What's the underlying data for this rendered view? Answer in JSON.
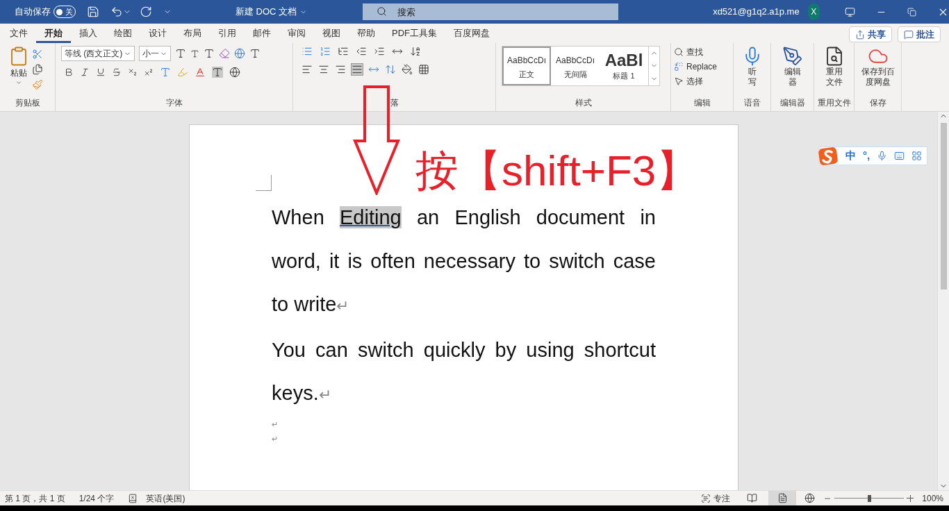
{
  "title_bar": {
    "autosave_label": "自动保存",
    "autosave": {
      "on": false,
      "label": "关"
    },
    "title": "新建 DOC 文档",
    "search": {
      "placeholder": "搜索"
    },
    "user": "xd521@g1q2.a1p.me",
    "avatar": "X"
  },
  "tabs": [
    {
      "label": "文件",
      "selected": false
    },
    {
      "label": "开始",
      "selected": true
    },
    {
      "label": "插入",
      "selected": false
    },
    {
      "label": "绘图",
      "selected": false
    },
    {
      "label": "设计",
      "selected": false
    },
    {
      "label": "布局",
      "selected": false
    },
    {
      "label": "引用",
      "selected": false
    },
    {
      "label": "邮件",
      "selected": false
    },
    {
      "label": "审阅",
      "selected": false
    },
    {
      "label": "视图",
      "selected": false
    },
    {
      "label": "帮助",
      "selected": false
    },
    {
      "label": "PDF工具集",
      "selected": false
    },
    {
      "label": "百度网盘",
      "selected": false
    }
  ],
  "share_buttons": [
    "共享",
    "批注"
  ],
  "ribbon": {
    "clipboard": {
      "paste": "粘贴",
      "label": "剪贴板"
    },
    "font": {
      "font_name": "等线 (西文正文)",
      "font_size": "小一",
      "label": "字体"
    },
    "paragraph": {
      "label": "落"
    },
    "styles": {
      "label": "样式",
      "items": [
        {
          "preview": "AaBbCcDı",
          "name": "正文",
          "kind": "normal",
          "selected": true
        },
        {
          "preview": "AaBbCcDı",
          "name": "无间隔",
          "kind": "normal",
          "selected": false
        },
        {
          "preview": "AaBl",
          "name": "标题 1",
          "kind": "heading",
          "selected": false
        }
      ]
    },
    "editing": {
      "label": "编辑",
      "items": [
        "查找",
        "Replace",
        "选择"
      ]
    },
    "big_groups": [
      {
        "button": "听写",
        "label": "语音",
        "kind": "mic"
      },
      {
        "button": "编辑器",
        "label": "编辑器",
        "kind": "pen"
      },
      {
        "button": "重用文件",
        "label": "重用文件",
        "kind": "reuse"
      },
      {
        "button": "保存到百度网盘",
        "label": "保存",
        "kind": "cloud"
      }
    ]
  },
  "document": {
    "paragraphs": [
      {
        "lines": [
          [
            {
              "text": "When "
            },
            {
              "text": "Editing",
              "selected": true
            },
            {
              "text": " an English document in"
            }
          ],
          [
            {
              "text": "word, it is often necessary to switch case"
            }
          ],
          [
            {
              "text": "to write"
            }
          ]
        ],
        "mark": "↵"
      },
      {
        "lines": [
          [
            {
              "text": "You can switch quickly by using shortcut"
            }
          ],
          [
            {
              "text": "keys."
            }
          ]
        ],
        "mark": "↵"
      }
    ],
    "empty_marks": [
      "↵",
      "↵"
    ]
  },
  "annotation": {
    "text": "按【shift+F3】"
  },
  "ime_bar": {
    "mode": "中",
    "punct": "°,"
  },
  "status_bar": {
    "page": "第 1 页，共 1 页",
    "words": "1/24 个字",
    "language": "英语(美国)",
    "focus": "专注",
    "zoom": {
      "level": 0.5,
      "reading": "100%"
    }
  }
}
